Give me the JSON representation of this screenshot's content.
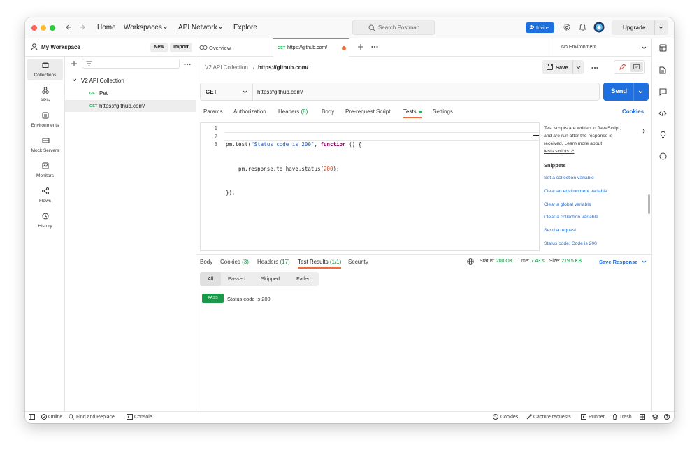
{
  "titlebar": {
    "nav": [
      "Home",
      "Workspaces",
      "API Network",
      "Explore"
    ],
    "search_placeholder": "Search Postman",
    "invite_label": "Invite",
    "upgrade_label": "Upgrade"
  },
  "workspace": {
    "name": "My Workspace",
    "new_label": "New",
    "import_label": "Import"
  },
  "rail": [
    {
      "label": "Collections",
      "icon": "collections-icon"
    },
    {
      "label": "APIs",
      "icon": "apis-icon"
    },
    {
      "label": "Environments",
      "icon": "environments-icon"
    },
    {
      "label": "Mock Servers",
      "icon": "mock-servers-icon"
    },
    {
      "label": "Monitors",
      "icon": "monitors-icon"
    },
    {
      "label": "Flows",
      "icon": "flows-icon"
    },
    {
      "label": "History",
      "icon": "history-icon"
    }
  ],
  "sidebar": {
    "collection": "V2 API Collection",
    "requests": [
      {
        "method": "GET",
        "name": "Pet"
      },
      {
        "method": "GET",
        "name": "https://github.com/"
      }
    ]
  },
  "tabs": {
    "overview_label": "Overview",
    "active_method": "GET",
    "active_label": "https://github.com/",
    "environment": "No Environment"
  },
  "breadcrumb": {
    "parent": "V2 API Collection",
    "separator": "/",
    "current": "https://github.com/",
    "save_label": "Save"
  },
  "request": {
    "method": "GET",
    "url": "https://github.com/",
    "send_label": "Send"
  },
  "request_tabs": {
    "params": "Params",
    "authorization": "Authorization",
    "headers": "Headers",
    "headers_count": "(8)",
    "body": "Body",
    "prerequest": "Pre-request Script",
    "tests": "Tests",
    "settings": "Settings",
    "cookies": "Cookies"
  },
  "editor": {
    "line_numbers": [
      "1",
      "2",
      "3"
    ],
    "lines": {
      "l1_a": "pm.test(",
      "l1_str": "\"Status code is 200\"",
      "l1_b": ", ",
      "l1_kw": "function",
      "l1_c": " () {",
      "l2_a": "    pm.response.to.have.status(",
      "l2_num": "200",
      "l2_b": ");",
      "l3": "});"
    }
  },
  "help": {
    "text1": "Test scripts are written in JavaScript,",
    "text2": "and are run after the response is",
    "text3": "received. Learn more about",
    "link": "tests scripts ↗",
    "snippets_title": "Snippets",
    "snippets": [
      "Set a collection variable",
      "Clear an environment variable",
      "Clear a global variable",
      "Clear a collection variable",
      "Send a request",
      "Status code: Code is 200"
    ]
  },
  "response": {
    "tabs": {
      "body": "Body",
      "cookies": "Cookies",
      "cookies_count": "(3)",
      "headers": "Headers",
      "headers_count": "(17)",
      "test_results": "Test Results",
      "test_results_count": "(1/1)",
      "security": "Security"
    },
    "status_label": "Status:",
    "status_value": "200 OK",
    "time_label": "Time:",
    "time_value": "7.43 s",
    "size_label": "Size:",
    "size_value": "219.5 KB",
    "save_response": "Save Response",
    "filters": [
      "All",
      "Passed",
      "Skipped",
      "Failed"
    ],
    "result": {
      "badge": "PASS",
      "name": "Status code is 200"
    }
  },
  "statusbar": {
    "online": "Online",
    "find_replace": "Find and Replace",
    "console": "Console",
    "cookies": "Cookies",
    "capture": "Capture requests",
    "runner": "Runner",
    "trash": "Trash"
  },
  "colors": {
    "accent_orange": "#f26b3a",
    "primary_blue": "#1f6fde",
    "get_green": "#0cbb52",
    "pass_green": "#1a9a48"
  }
}
